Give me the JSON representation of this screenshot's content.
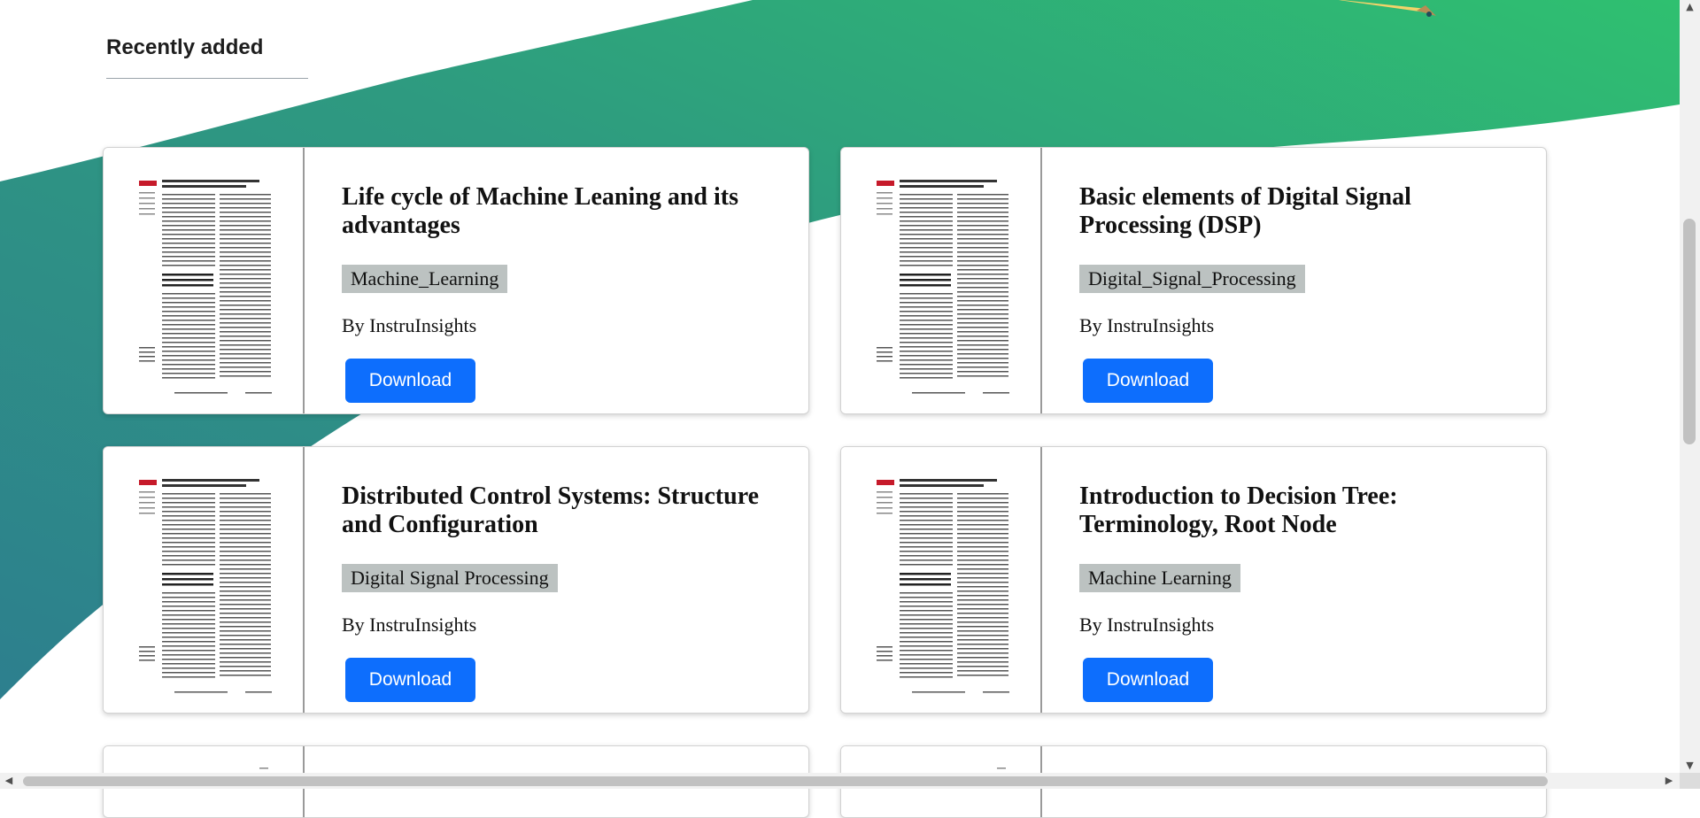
{
  "section": {
    "title": "Recently added"
  },
  "colors": {
    "accent": "#0d6efd",
    "wave_green": "#2fbe72",
    "wave_teal": "#2f8a8a",
    "tag_bg": "#bcc2c1"
  },
  "cards": [
    {
      "title": "Life cycle of Machine Leaning and its advantages",
      "tag": "Machine_Learning",
      "author": "By InstruInsights",
      "button": "Download"
    },
    {
      "title": "Basic elements of Digital Signal Processing (DSP)",
      "tag": "Digital_Signal_Processing",
      "author": "By InstruInsights",
      "button": "Download"
    },
    {
      "title": "Distributed Control Systems: Structure and Configuration",
      "tag": "Digital Signal Processing",
      "author": "By InstruInsights",
      "button": "Download"
    },
    {
      "title": "Introduction to Decision Tree: Terminology, Root Node",
      "tag": "Machine Learning",
      "author": "By InstruInsights",
      "button": "Download"
    }
  ],
  "scrollbars": {
    "up_icon": "triangle-up-icon",
    "down_icon": "triangle-down-icon",
    "left_icon": "triangle-left-icon",
    "right_icon": "triangle-right-icon"
  }
}
